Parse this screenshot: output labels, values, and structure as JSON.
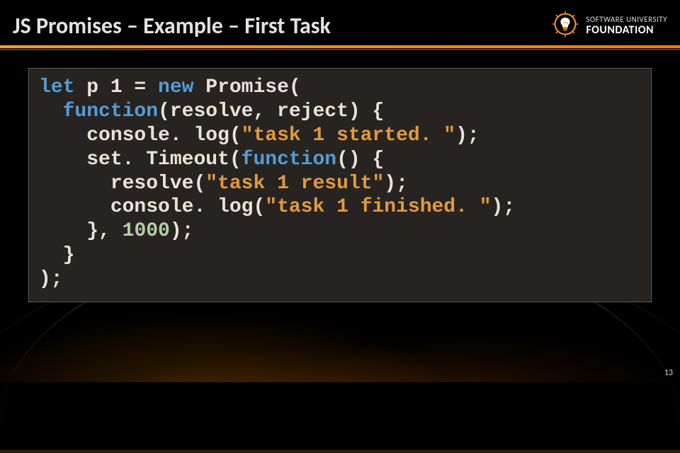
{
  "slide": {
    "title": "JS Promises – Example – First Task",
    "page_number": "13"
  },
  "branding": {
    "line1": "SOFTWARE UNIVERSITY",
    "line2": "FOUNDATION",
    "icon": "lightbulb-gear-icon"
  },
  "code": {
    "lines": [
      {
        "indent": 0,
        "tokens": [
          {
            "t": "let ",
            "c": "k-blue"
          },
          {
            "t": "p 1 = ",
            "c": ""
          },
          {
            "t": "new ",
            "c": "k-blue"
          },
          {
            "t": "Promise(",
            "c": ""
          }
        ]
      },
      {
        "indent": 1,
        "tokens": [
          {
            "t": "function",
            "c": "k-blue"
          },
          {
            "t": "(resolve, reject) {",
            "c": ""
          }
        ]
      },
      {
        "indent": 2,
        "tokens": [
          {
            "t": "console. log(",
            "c": ""
          },
          {
            "t": "\"task 1 started. \"",
            "c": "k-orange"
          },
          {
            "t": ");",
            "c": ""
          }
        ]
      },
      {
        "indent": 2,
        "tokens": [
          {
            "t": "set. Timeout(",
            "c": ""
          },
          {
            "t": "function",
            "c": "k-blue"
          },
          {
            "t": "() {",
            "c": ""
          }
        ]
      },
      {
        "indent": 3,
        "tokens": [
          {
            "t": "resolve(",
            "c": ""
          },
          {
            "t": "\"task 1 result\"",
            "c": "k-orange"
          },
          {
            "t": ");",
            "c": ""
          }
        ]
      },
      {
        "indent": 3,
        "tokens": [
          {
            "t": "console. log(",
            "c": ""
          },
          {
            "t": "\"task 1 finished. \"",
            "c": "k-orange"
          },
          {
            "t": ");",
            "c": ""
          }
        ]
      },
      {
        "indent": 2,
        "tokens": [
          {
            "t": "}, ",
            "c": ""
          },
          {
            "t": "1000",
            "c": "k-num"
          },
          {
            "t": ");",
            "c": ""
          }
        ]
      },
      {
        "indent": 1,
        "tokens": [
          {
            "t": "}",
            "c": ""
          }
        ]
      },
      {
        "indent": 0,
        "tokens": [
          {
            "t": ");",
            "c": ""
          }
        ]
      }
    ]
  }
}
